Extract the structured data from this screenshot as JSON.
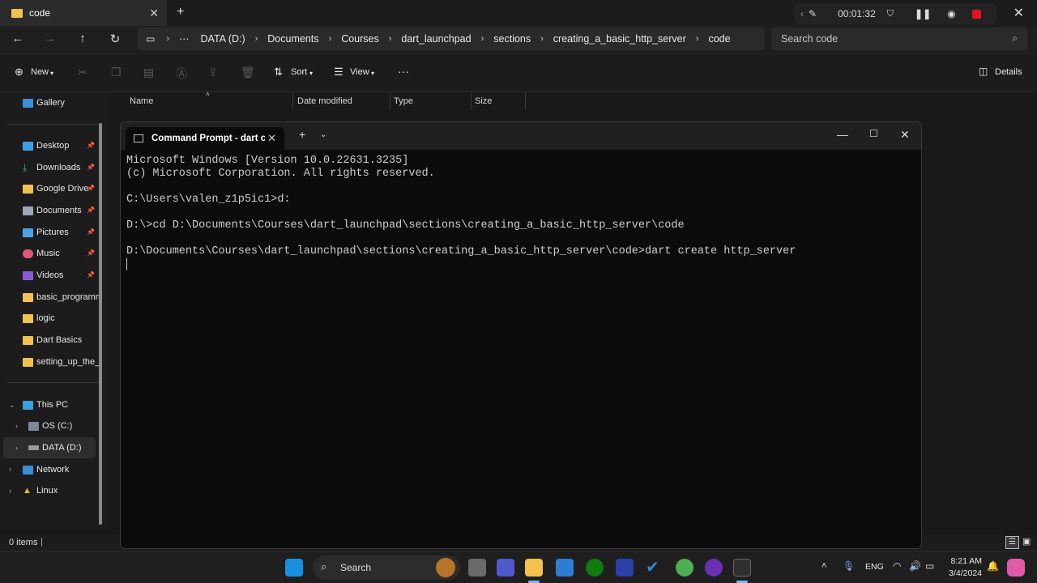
{
  "explorer": {
    "tab_title": "code",
    "breadcrumbs": [
      "DATA (D:)",
      "Documents",
      "Courses",
      "dart_launchpad",
      "sections",
      "creating_a_basic_http_server",
      "code"
    ],
    "search_placeholder": "Search code",
    "commands": {
      "new": "New",
      "sort": "Sort",
      "view": "View",
      "details": "Details"
    },
    "columns": [
      "Name",
      "Date modified",
      "Type",
      "Size"
    ],
    "sidebar": {
      "quick": [
        {
          "label": "Gallery"
        },
        {
          "label": "Desktop"
        },
        {
          "label": "Downloads"
        },
        {
          "label": "Google Drive"
        },
        {
          "label": "Documents"
        },
        {
          "label": "Pictures"
        },
        {
          "label": "Music"
        },
        {
          "label": "Videos"
        },
        {
          "label": "basic_programm"
        },
        {
          "label": "logic"
        },
        {
          "label": "Dart Basics"
        },
        {
          "label": "setting_up_the_e"
        }
      ],
      "this_pc": "This PC",
      "drives": [
        "OS (C:)",
        "DATA (D:)"
      ],
      "network": "Network",
      "linux": "Linux"
    },
    "status": "0 items"
  },
  "recorder": {
    "time": "00:01:32"
  },
  "terminal": {
    "tab_title": "Command Prompt - dart  crea",
    "lines": [
      "Microsoft Windows [Version 10.0.22631.3235]",
      "(c) Microsoft Corporation. All rights reserved.",
      "",
      "C:\\Users\\valen_z1p5ic1>d:",
      "",
      "D:\\>cd D:\\Documents\\Courses\\dart_launchpad\\sections\\creating_a_basic_http_server\\code",
      "",
      "D:\\Documents\\Courses\\dart_launchpad\\sections\\creating_a_basic_http_server\\code>dart create http_server"
    ]
  },
  "taskbar": {
    "search": "Search",
    "lang": "ENG",
    "time": "8:21 AM",
    "date": "3/4/2024"
  },
  "colors": {
    "folder": "#f2c14e",
    "accent": "#0078d4",
    "record": "#e81123"
  }
}
